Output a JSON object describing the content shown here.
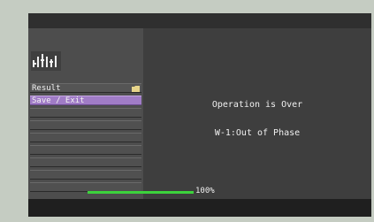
{
  "menu": {
    "items": [
      {
        "label": "Result",
        "icon": "folder-icon",
        "selected": false
      },
      {
        "label": "Save / Exit",
        "icon": "",
        "selected": true
      },
      {
        "label": "",
        "selected": false
      },
      {
        "label": "",
        "selected": false
      },
      {
        "label": "",
        "selected": false
      },
      {
        "label": "",
        "selected": false
      },
      {
        "label": "",
        "selected": false
      },
      {
        "label": "",
        "selected": false
      },
      {
        "label": "",
        "selected": false
      }
    ]
  },
  "main": {
    "status": "Operation is Over",
    "message": "W-1:Out of Phase",
    "progress_percent": 100,
    "progress_label": "100%"
  },
  "colors": {
    "selected": "#a07cc6",
    "progress": "#3cd33c"
  }
}
